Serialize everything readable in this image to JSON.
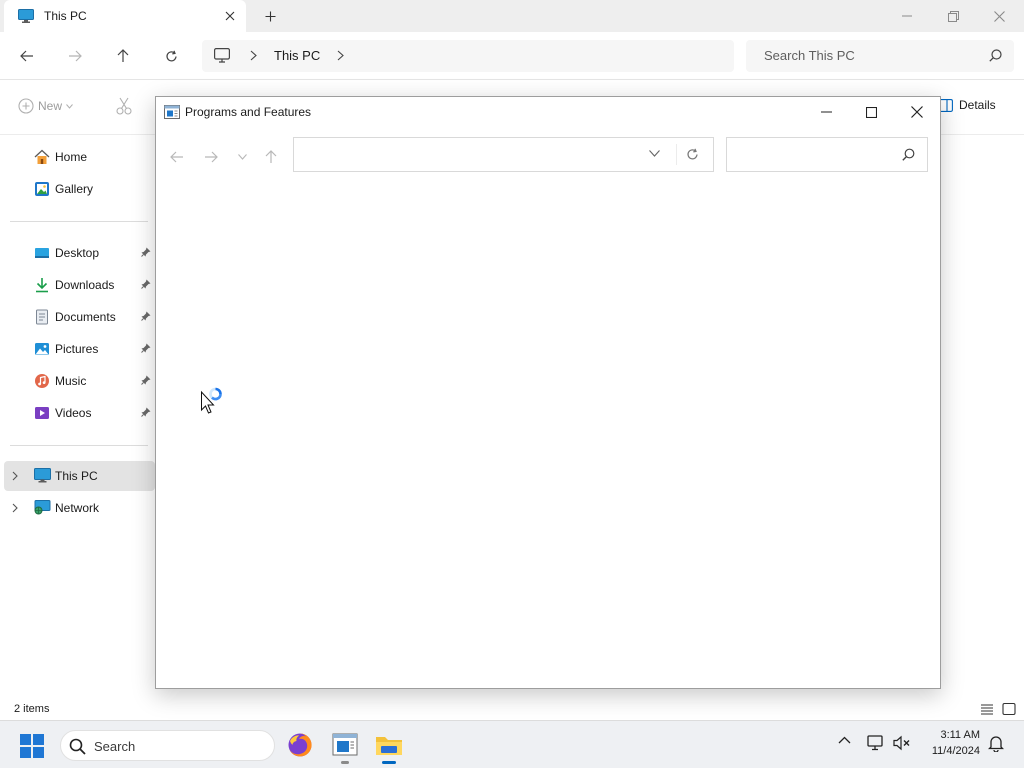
{
  "explorer": {
    "tab_title": "This PC",
    "address_crumb": "This PC",
    "search_placeholder": "Search This PC",
    "command_bar": {
      "new_label": "New",
      "details_label": "Details"
    },
    "sidebar": {
      "quick": [
        {
          "label": "Home",
          "icon": "home-icon"
        },
        {
          "label": "Gallery",
          "icon": "gallery-icon"
        }
      ],
      "pinned": [
        {
          "label": "Desktop",
          "icon": "desktop-icon"
        },
        {
          "label": "Downloads",
          "icon": "downloads-icon"
        },
        {
          "label": "Documents",
          "icon": "documents-icon"
        },
        {
          "label": "Pictures",
          "icon": "pictures-icon"
        },
        {
          "label": "Music",
          "icon": "music-icon"
        },
        {
          "label": "Videos",
          "icon": "videos-icon"
        }
      ],
      "devices": [
        {
          "label": "This PC",
          "icon": "this-pc-icon",
          "selected": true
        },
        {
          "label": "Network",
          "icon": "network-icon"
        }
      ]
    },
    "status_text": "2 items"
  },
  "dialog": {
    "title": "Programs and Features",
    "address_value": "",
    "search_value": ""
  },
  "taskbar": {
    "search_placeholder": "Search",
    "apps": [
      "firefox-icon",
      "programs-and-features-icon",
      "file-explorer-icon"
    ],
    "clock_time": "3:11 AM",
    "clock_date": "11/4/2024"
  },
  "colors": {
    "accent": "#0067c0",
    "folder_yellow": "#f3c13a",
    "selected_bg": "#e3e3e3"
  }
}
